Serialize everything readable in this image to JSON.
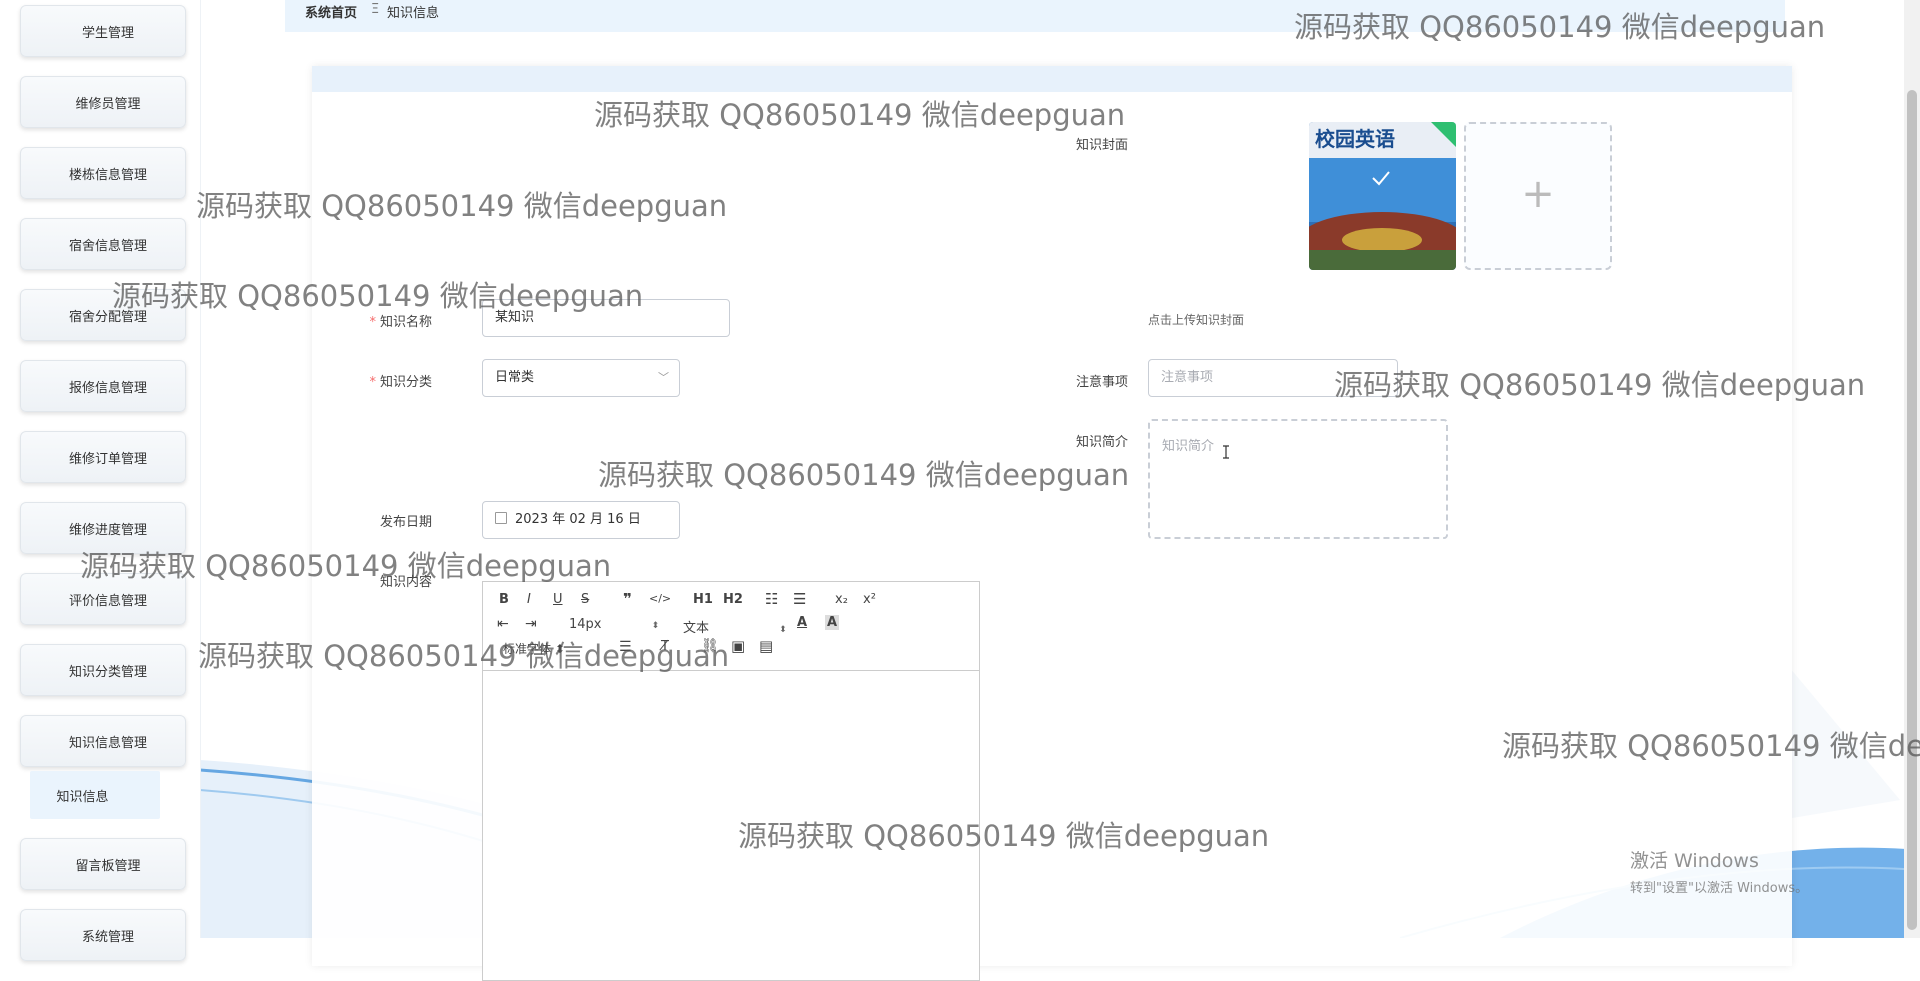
{
  "sidebar": {
    "items": [
      {
        "label": "学生管理"
      },
      {
        "label": "维修员管理"
      },
      {
        "label": "楼栋信息管理"
      },
      {
        "label": "宿舍信息管理"
      },
      {
        "label": "宿舍分配管理"
      },
      {
        "label": "报修信息管理"
      },
      {
        "label": "维修订单管理"
      },
      {
        "label": "维修进度管理"
      },
      {
        "label": "评价信息管理"
      },
      {
        "label": "知识分类管理"
      },
      {
        "label": "知识信息管理"
      },
      {
        "label": "留言板管理"
      },
      {
        "label": "系统管理"
      }
    ],
    "active_sub_item": "知识信息"
  },
  "breadcrumb": {
    "home": "系统首页",
    "separator": "Ξ",
    "current": "知识信息"
  },
  "form": {
    "cover_label": "知识封面",
    "cover_image_title": "校园英语",
    "upload_hint": "点击上传知识封面",
    "name_label": "知识名称",
    "name_value": "某知识",
    "category_label": "知识分类",
    "category_value": "日常类",
    "notice_label": "注意事项",
    "notice_placeholder": "注意事项",
    "intro_label": "知识简介",
    "intro_placeholder": "知识简介",
    "date_label": "发布日期",
    "date_value": "2023 年 02 月 16 日",
    "content_label": "知识内容"
  },
  "editor": {
    "font_size": "14px",
    "font_family": "文本",
    "heading_select": "标准字体",
    "buttons": [
      "bold",
      "italic",
      "underline",
      "strike",
      "blockquote",
      "code-block",
      "h1",
      "h2",
      "ordered-list",
      "bullet-list",
      "subscript",
      "superscript",
      "indent",
      "outdent",
      "font-color",
      "background-color",
      "align",
      "clean",
      "link",
      "image",
      "video"
    ],
    "labels": {
      "h1": "H1",
      "h2": "H2",
      "x2sub": "x₂",
      "x2sup": "x²"
    }
  },
  "watermarks": [
    "源码获取 QQ86050149 微信deepguan",
    "源码获取 QQ86050149 微信deepguan",
    "源码获取 QQ86050149 微信deepguan",
    "源码获取 QQ86050149 微信deepguan",
    "源码获取 QQ86050149 微信deepguan",
    "源码获取 QQ86050149 微信deepguan",
    "源码获取 QQ86050149 微信deepguan",
    "源码获取 QQ86050149 微信deepguan",
    "源码获取 QQ86050149 微信de",
    "源码获取 QQ86050149 微信deepguan"
  ],
  "os_notice": {
    "title": "激活 Windows",
    "subtitle": "转到\"设置\"以激活 Windows。"
  },
  "colors": {
    "accent": "#409eff",
    "required": "#f56c6c",
    "breadcrumb_bg": "#eaf4fd",
    "card_header": "#e7f1fb"
  }
}
